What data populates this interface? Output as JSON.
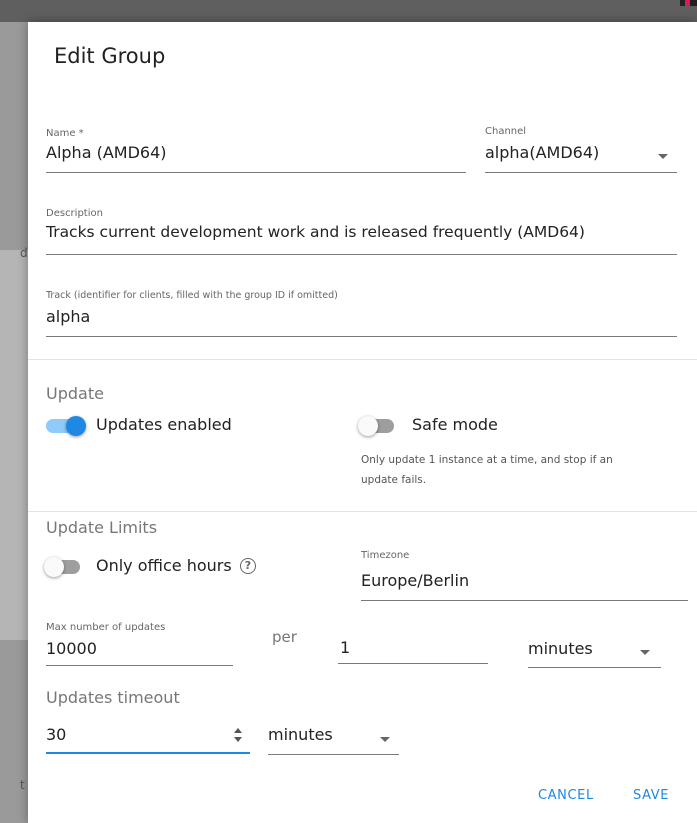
{
  "dialog": {
    "title": "Edit Group"
  },
  "form": {
    "name": {
      "label": "Name *",
      "value": "Alpha (AMD64)"
    },
    "channel": {
      "label": "Channel",
      "value": "alpha(AMD64)"
    },
    "description": {
      "label": "Description",
      "value": "Tracks current development work and is released frequently (AMD64)"
    },
    "track": {
      "label": "Track (identifier for clients, filled with the group ID if omitted)",
      "value": "alpha"
    }
  },
  "update": {
    "section_label": "Update",
    "updates_enabled": {
      "label": "Updates enabled",
      "on": true
    },
    "safe_mode": {
      "label": "Safe mode",
      "on": false,
      "note": "Only update 1 instance at a time, and stop if an update fails."
    }
  },
  "update_limits": {
    "section_label": "Update Limits",
    "office_hours": {
      "label": "Only office hours",
      "on": false,
      "help_icon": "help-circle-icon"
    },
    "timezone": {
      "label": "Timezone",
      "value": "Europe/Berlin"
    },
    "max_updates": {
      "label": "Max number of updates",
      "value": "10000"
    },
    "per_label": "per",
    "per_value": "1",
    "per_unit": "minutes"
  },
  "timeout": {
    "section_label": "Updates timeout",
    "value": "30",
    "unit": "minutes"
  },
  "actions": {
    "cancel": "CANCEL",
    "save": "SAVE"
  },
  "backdrop": {
    "fragment_1": "d",
    "fragment_2": "t"
  },
  "colors": {
    "accent": "#1e88e5",
    "accent_light": "#90caf9",
    "switch_off_track": "#9e9e9e",
    "switch_off_knob": "#fafafa"
  }
}
